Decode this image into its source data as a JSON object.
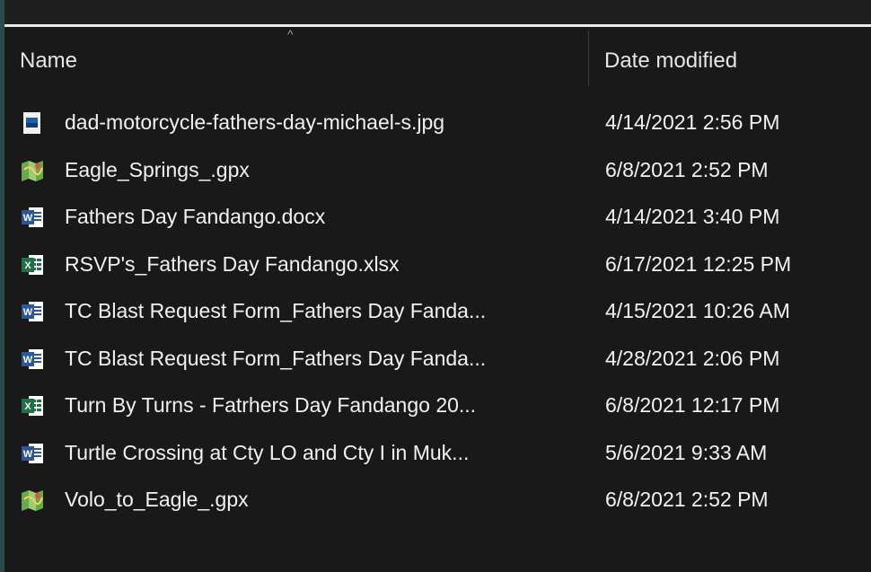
{
  "header": {
    "name_label": "Name",
    "date_label": "Date modified",
    "sort_glyph": "^"
  },
  "files": [
    {
      "name": "dad-motorcycle-fathers-day-michael-s.jpg",
      "date": "4/14/2021 2:56 PM",
      "icon": "image-file-icon"
    },
    {
      "name": "Eagle_Springs_.gpx",
      "date": "6/8/2021 2:52 PM",
      "icon": "map-file-icon"
    },
    {
      "name": "Fathers Day Fandango.docx",
      "date": "4/14/2021 3:40 PM",
      "icon": "word-file-icon"
    },
    {
      "name": "RSVP's_Fathers Day Fandango.xlsx",
      "date": "6/17/2021 12:25 PM",
      "icon": "excel-file-icon"
    },
    {
      "name": "TC Blast Request Form_Fathers Day Fanda...",
      "date": "4/15/2021 10:26 AM",
      "icon": "word-file-icon"
    },
    {
      "name": "TC Blast Request Form_Fathers Day Fanda...",
      "date": "4/28/2021 2:06 PM",
      "icon": "word-file-icon"
    },
    {
      "name": "Turn By Turns - Fatrhers Day Fandango 20...",
      "date": "6/8/2021 12:17 PM",
      "icon": "excel-file-icon"
    },
    {
      "name": "Turtle Crossing at Cty LO and Cty I in Muk...",
      "date": "5/6/2021 9:33 AM",
      "icon": "word-file-icon"
    },
    {
      "name": "Volo_to_Eagle_.gpx",
      "date": "6/8/2021 2:52 PM",
      "icon": "map-file-icon"
    }
  ],
  "colors": {
    "background": "#191919",
    "text": "#f2f2f2",
    "word": "#2b5797",
    "excel": "#1e7145"
  }
}
